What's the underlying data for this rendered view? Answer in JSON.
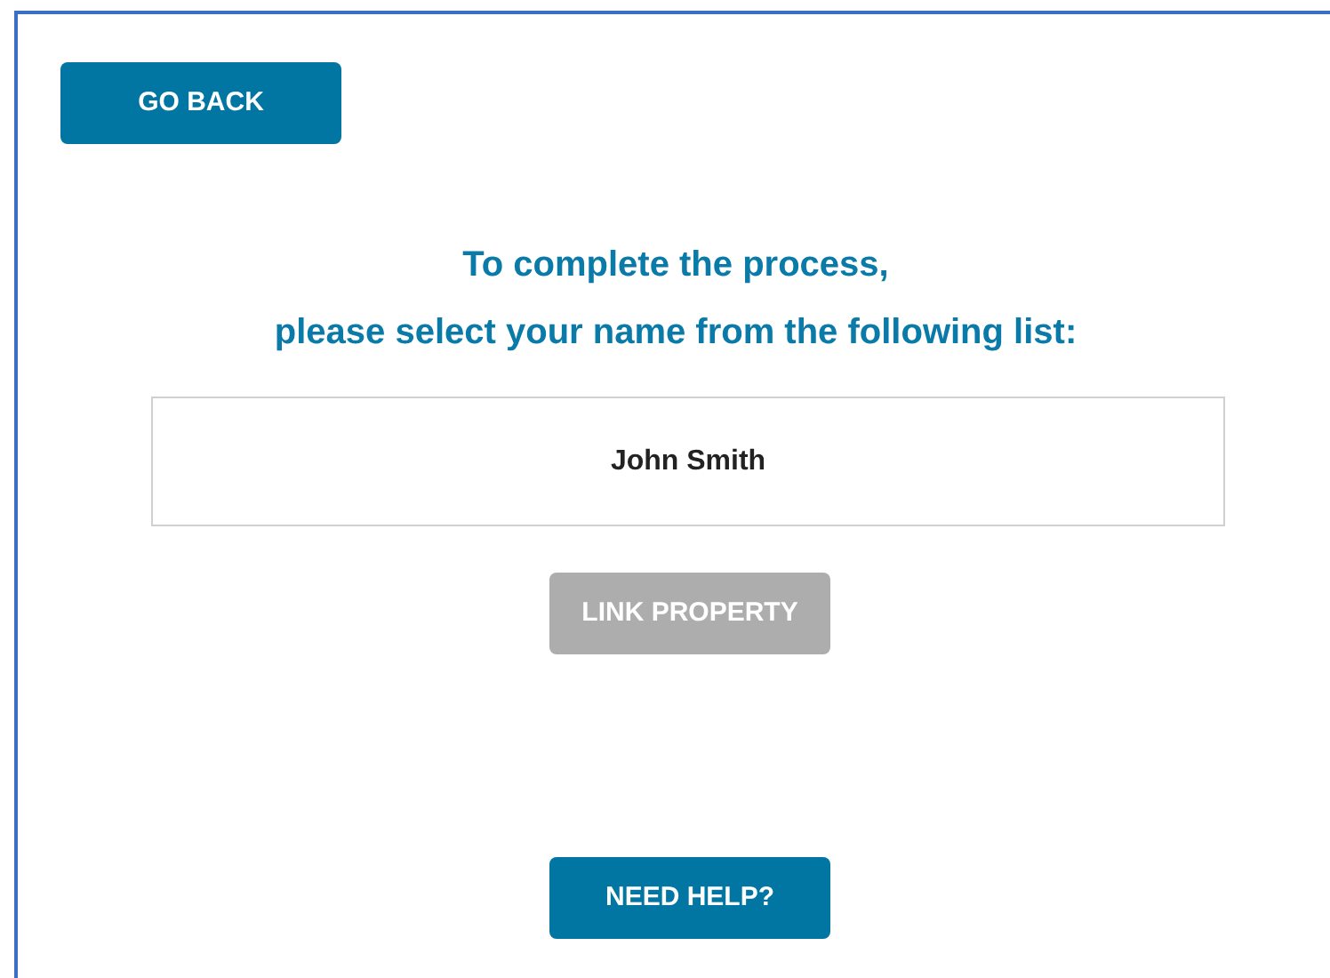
{
  "go_back": {
    "label": "GO BACK"
  },
  "heading": [
    "To complete the process,",
    "please select your name from the following list:"
  ],
  "names": [
    {
      "label": "John Smith",
      "selected": false
    }
  ],
  "link_button": {
    "label": "LINK PROPERTY",
    "disabled": true
  },
  "help_button": {
    "label": "NEED HELP?"
  }
}
